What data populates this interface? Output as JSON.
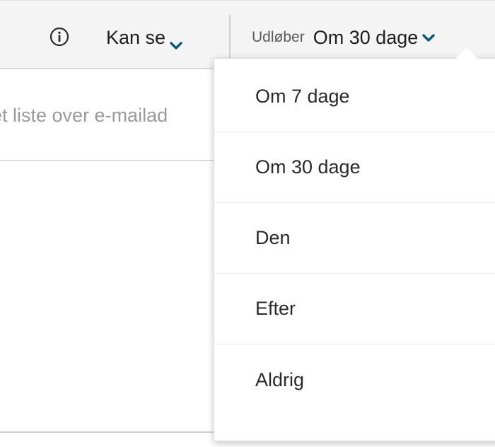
{
  "toolbar": {
    "info_icon": "info-circle-icon",
    "permission_label": "Kan se",
    "expiry_label": "Udløber",
    "expiry_value": "Om 30 dage",
    "chevron_icon": "chevron-down-icon"
  },
  "email_input": {
    "placeholder": "et liste over e-mailad"
  },
  "expiry_menu": {
    "items": [
      {
        "label": "Om 7 dage"
      },
      {
        "label": "Om 30 dage"
      },
      {
        "label": "Den"
      },
      {
        "label": "Efter"
      },
      {
        "label": "Aldrig"
      }
    ]
  },
  "colors": {
    "toolbar_bg": "#f4f4f4",
    "chevron": "#0a5a7a",
    "text": "#1e1e1e",
    "muted_text": "#5a5a5a",
    "placeholder": "#9a9a9a"
  }
}
